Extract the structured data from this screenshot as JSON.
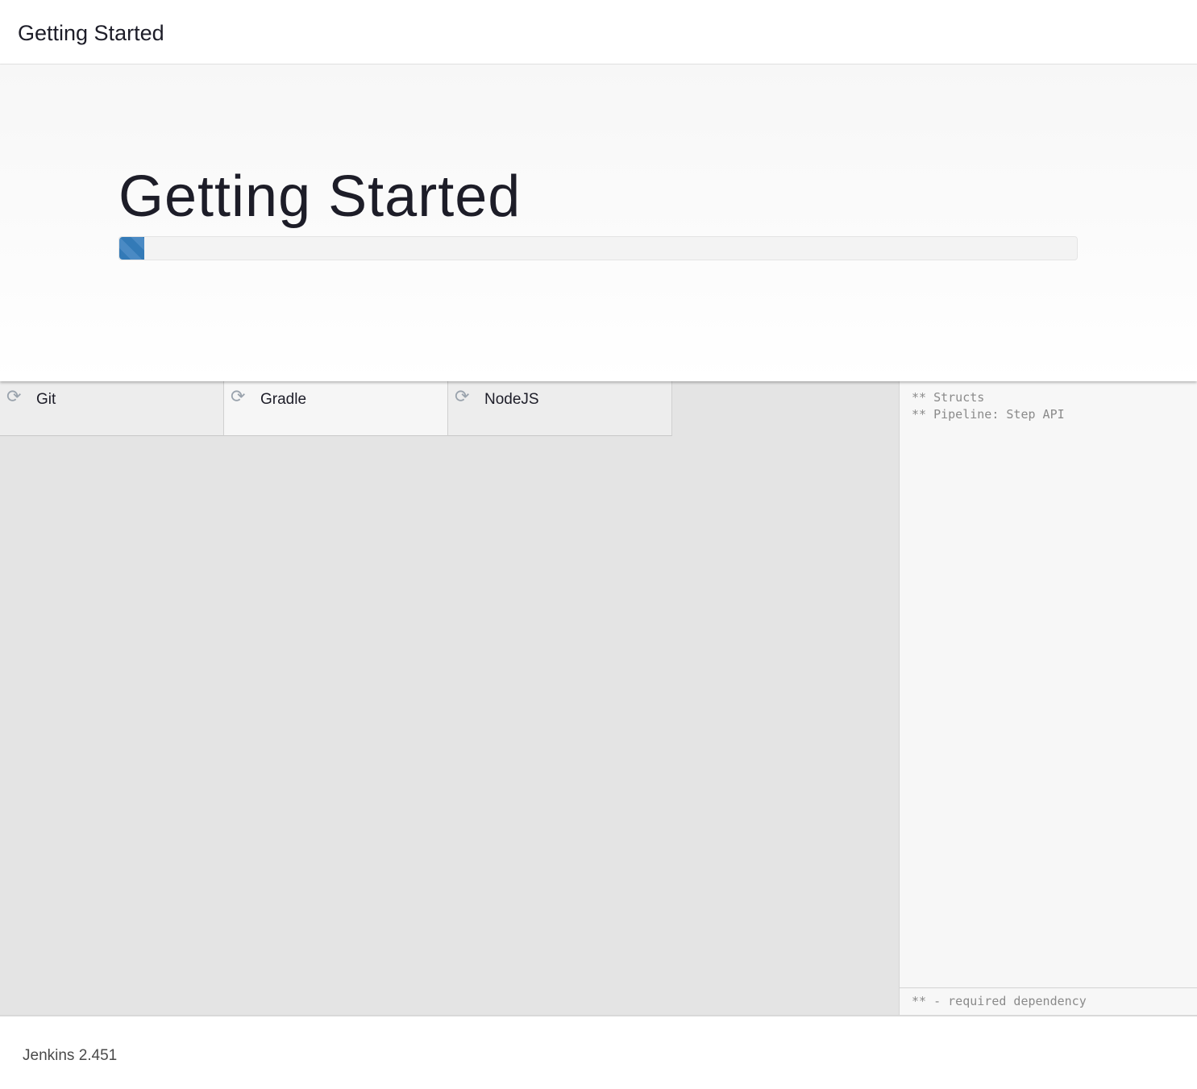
{
  "header": {
    "title": "Getting Started"
  },
  "jumbotron": {
    "title": "Getting Started",
    "progress_percent": 2.6
  },
  "plugins": [
    {
      "name": "Git",
      "status_icon": "refresh-icon"
    },
    {
      "name": "Gradle",
      "status_icon": "refresh-icon"
    },
    {
      "name": "NodeJS",
      "status_icon": "refresh-icon"
    }
  ],
  "log": {
    "lines": [
      "** Structs",
      "** Pipeline: Step API"
    ],
    "footer": "** - required dependency"
  },
  "footer": {
    "version": "Jenkins 2.451"
  },
  "colors": {
    "accent": "#337ab7",
    "panel": "#e4e4e4",
    "log_bg": "#f7f7f7"
  }
}
